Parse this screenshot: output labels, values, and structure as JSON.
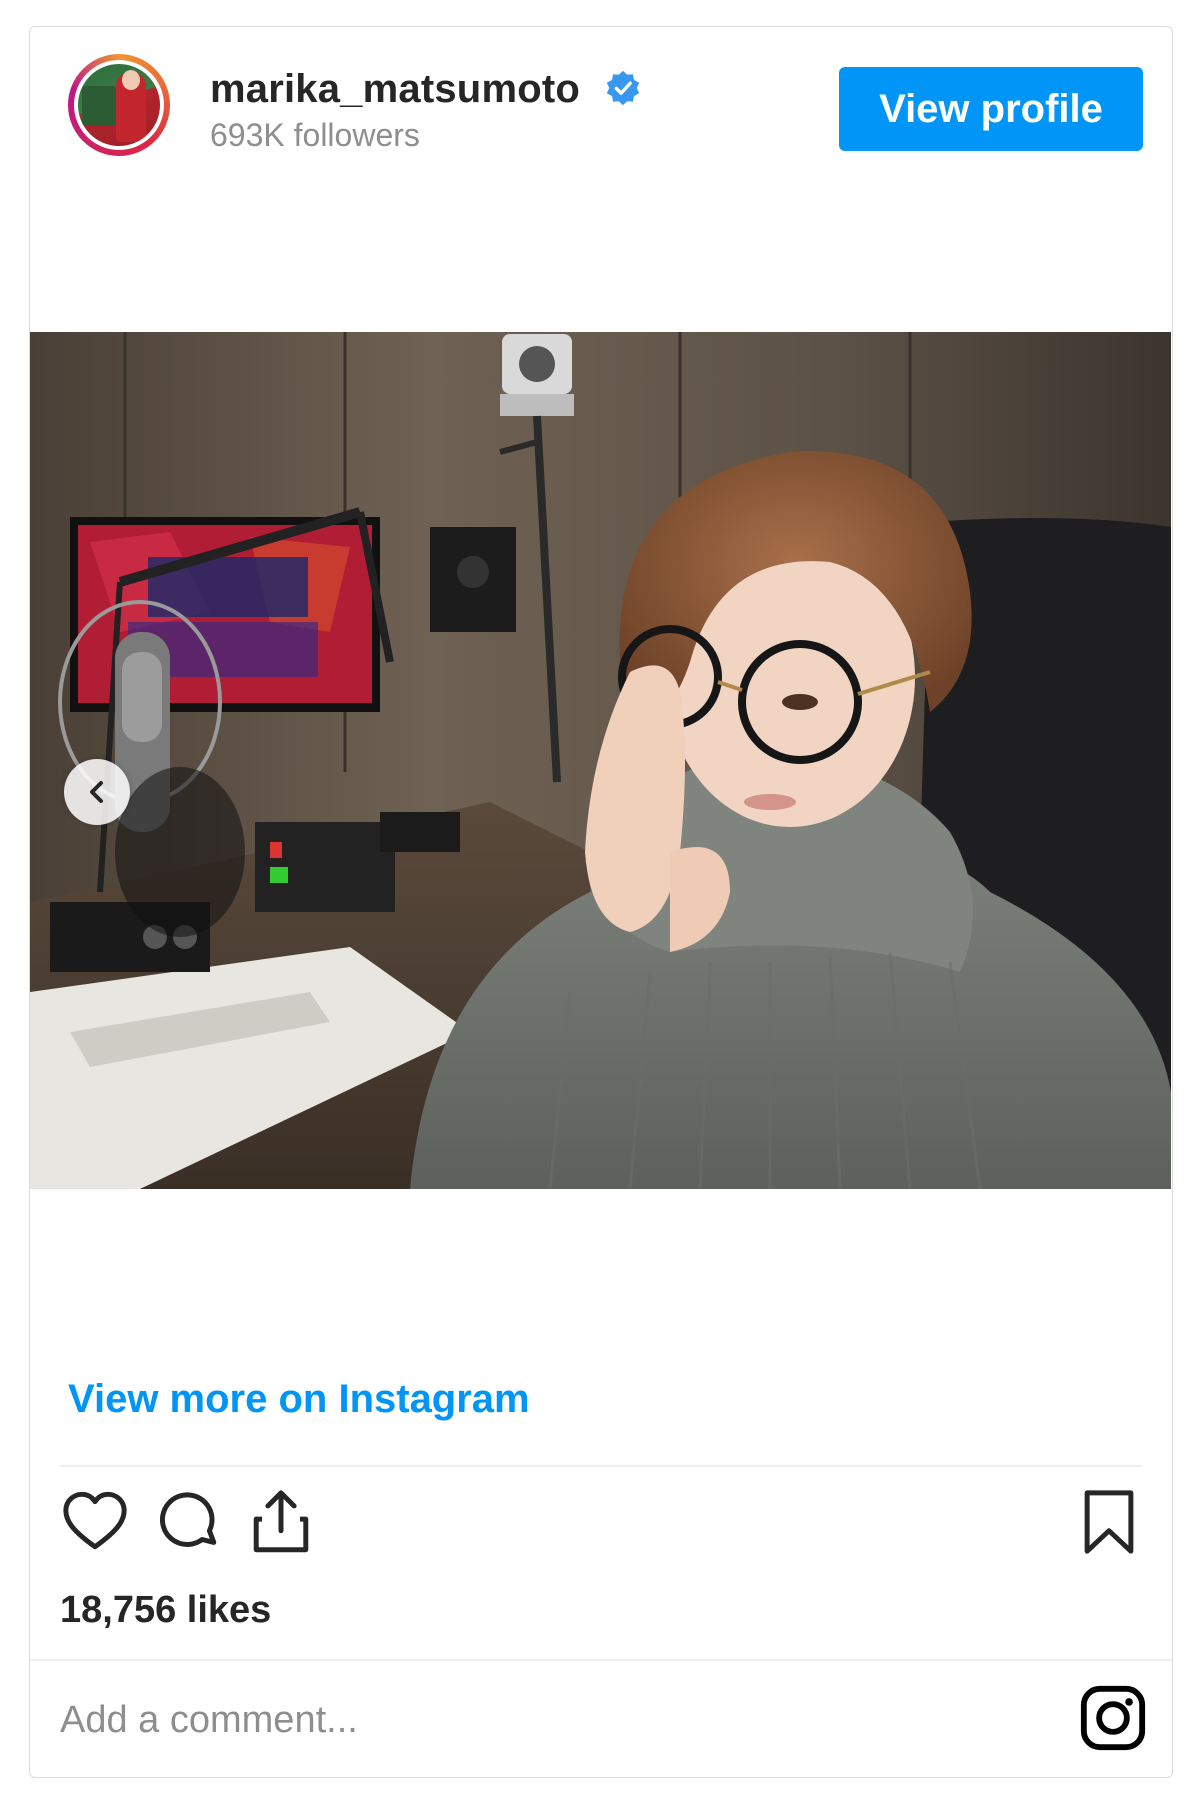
{
  "header": {
    "username": "marika_matsumoto",
    "followers": "693K followers",
    "view_profile_label": "View profile"
  },
  "post": {
    "image_alt": "Post photo",
    "view_more_label": "View more on Instagram",
    "likes": "18,756 likes",
    "comment_placeholder": "Add a comment..."
  },
  "icons": {
    "verified": "verified-badge-icon",
    "prev": "chevron-left-icon",
    "like": "heart-icon",
    "comment": "comment-icon",
    "share": "share-icon",
    "save": "bookmark-icon",
    "logo": "instagram-logo-icon"
  },
  "colors": {
    "accent": "#0095f6",
    "text": "#262626",
    "muted": "#8e8e8e",
    "border": "#dbdbdb"
  }
}
